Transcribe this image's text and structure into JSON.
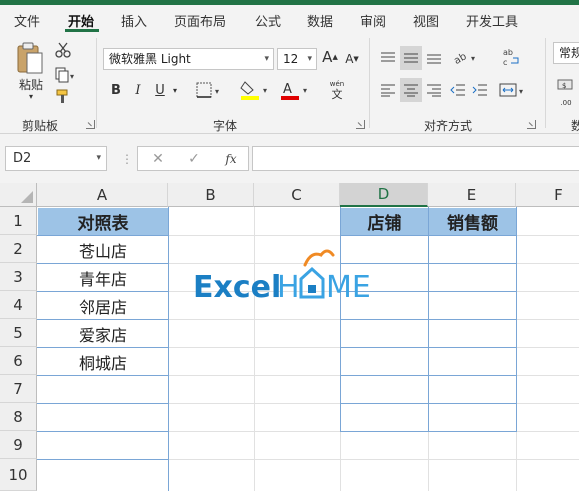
{
  "menu": {
    "tabs": [
      {
        "label": "文件",
        "active": false
      },
      {
        "label": "开始",
        "active": true
      },
      {
        "label": "插入",
        "active": false
      },
      {
        "label": "页面布局",
        "active": false
      },
      {
        "label": "公式",
        "active": false
      },
      {
        "label": "数据",
        "active": false
      },
      {
        "label": "审阅",
        "active": false
      },
      {
        "label": "视图",
        "active": false
      },
      {
        "label": "开发工具",
        "active": false
      }
    ]
  },
  "ribbon": {
    "clipboard": {
      "label": "剪贴板",
      "paste_label": "粘贴"
    },
    "font": {
      "label": "字体",
      "font_name": "微软雅黑 Light",
      "font_size": "12",
      "bold": "B",
      "italic": "I",
      "underline": "U",
      "grow": "A",
      "shrink": "A",
      "wen": "wén",
      "wen_char": "文",
      "font_color": "A",
      "font_color_hex": "#e00000",
      "fill_color_hex": "#ffff00"
    },
    "alignment": {
      "label": "对齐方式"
    },
    "number": {
      "format": "常规",
      "label": "数"
    }
  },
  "formula_bar": {
    "name_box": "D2",
    "fx": "fx",
    "content": ""
  },
  "sheet": {
    "columns": [
      "A",
      "B",
      "C",
      "D",
      "E",
      "F"
    ],
    "selected_column": "D",
    "rows": [
      "1",
      "2",
      "3",
      "4",
      "5",
      "6",
      "7",
      "8",
      "9",
      "10"
    ],
    "table_a": {
      "header": "对照表",
      "items": [
        "苍山店",
        "青年店",
        "邻居店",
        "爱家店",
        "桐城店"
      ]
    },
    "table_de": {
      "header_d": "店铺",
      "header_e": "销售额"
    },
    "header_fill": "#9dc3e6"
  },
  "watermark": {
    "part1": "Excel",
    "part2": "H",
    "part3": "ME",
    "color_dark": "#1b7fc4",
    "color_light": "#3aa3e3",
    "accent": "#f08a24"
  }
}
